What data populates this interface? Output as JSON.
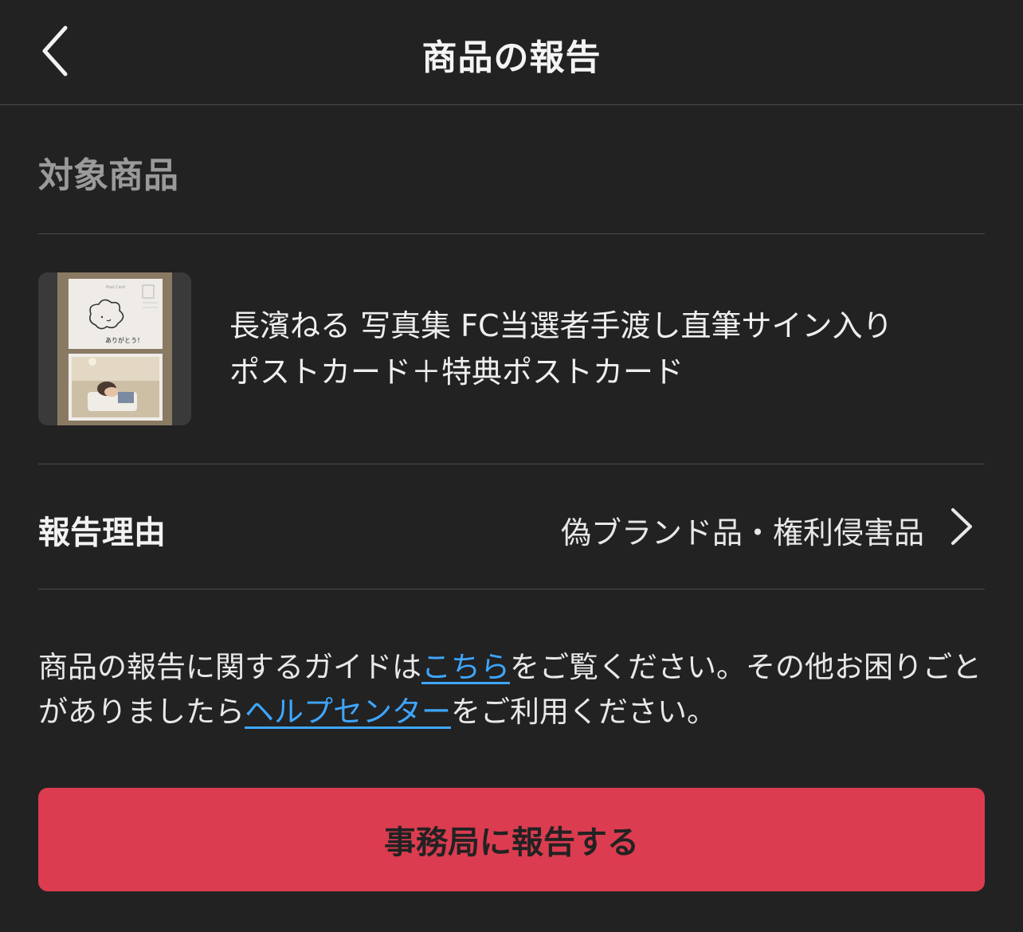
{
  "header": {
    "title": "商品の報告",
    "back_icon": "chevron-left-icon"
  },
  "target_section": {
    "title": "対象商品"
  },
  "product": {
    "name_line1": "長濱ねる 写真集 FC当選者手渡し直筆サイン入り",
    "name_line2": "ポストカード＋特典ポストカード",
    "thumb_card_text": "Post Card",
    "thumb_handwriting": "ありがとう！"
  },
  "reason": {
    "label": "報告理由",
    "value": "偽ブランド品・権利侵害品",
    "chevron_icon": "chevron-right-icon"
  },
  "guide": {
    "text_1": "商品の報告に関するガイドは",
    "link_1": "こちら",
    "text_2": "をご覧ください。その他お困りごとがありましたら",
    "link_2": "ヘルプセンター",
    "text_3": "をご利用ください。"
  },
  "submit": {
    "label": "事務局に報告する"
  },
  "colors": {
    "background": "#222222",
    "divider": "#4a4a4a",
    "link": "#3ea6ff",
    "submit_button": "#dc3c50",
    "muted_text": "#9a9a9a"
  }
}
